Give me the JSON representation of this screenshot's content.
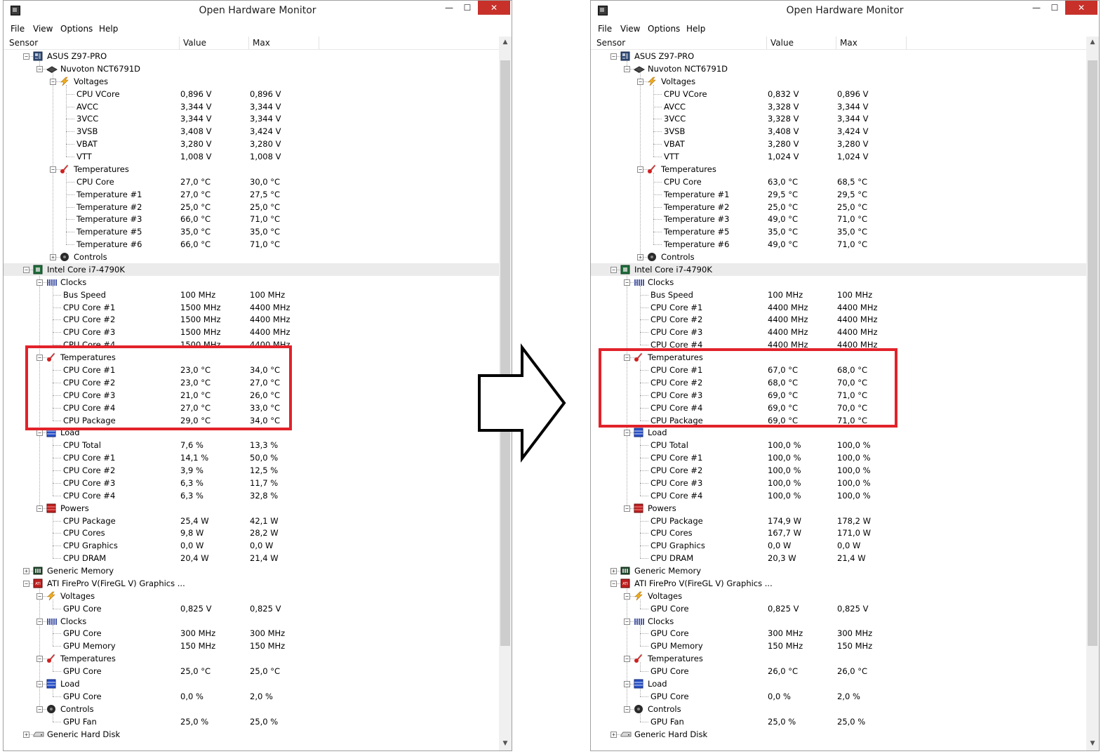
{
  "window": {
    "title": "Open Hardware Monitor",
    "menu": [
      "File",
      "View",
      "Options",
      "Help"
    ],
    "columns": {
      "sensor": "Sensor",
      "value": "Value",
      "max": "Max"
    }
  },
  "tree_before": [
    {
      "label": "ASUS Z97-PRO",
      "level": 1,
      "expander": "minus",
      "icon": "motherboard-icon"
    },
    {
      "label": "Nuvoton NCT6791D",
      "level": 2,
      "expander": "minus",
      "icon": "chip-icon"
    },
    {
      "label": "Voltages",
      "level": 3,
      "expander": "minus",
      "icon": "lightning-icon"
    },
    {
      "label": "CPU VCore",
      "level": 4,
      "value": "0,896 V",
      "max": "0,896 V"
    },
    {
      "label": "AVCC",
      "level": 4,
      "value": "3,344 V",
      "max": "3,344 V"
    },
    {
      "label": "3VCC",
      "level": 4,
      "value": "3,344 V",
      "max": "3,344 V"
    },
    {
      "label": "3VSB",
      "level": 4,
      "value": "3,408 V",
      "max": "3,424 V"
    },
    {
      "label": "VBAT",
      "level": 4,
      "value": "3,280 V",
      "max": "3,280 V"
    },
    {
      "label": "VTT",
      "level": 4,
      "value": "1,008 V",
      "max": "1,008 V"
    },
    {
      "label": "Temperatures",
      "level": 3,
      "expander": "minus",
      "icon": "thermometer-icon"
    },
    {
      "label": "CPU Core",
      "level": 4,
      "value": "27,0 °C",
      "max": "30,0 °C"
    },
    {
      "label": "Temperature #1",
      "level": 4,
      "value": "27,0 °C",
      "max": "27,5 °C"
    },
    {
      "label": "Temperature #2",
      "level": 4,
      "value": "25,0 °C",
      "max": "25,0 °C"
    },
    {
      "label": "Temperature #3",
      "level": 4,
      "value": "66,0 °C",
      "max": "71,0 °C"
    },
    {
      "label": "Temperature #5",
      "level": 4,
      "value": "35,0 °C",
      "max": "35,0 °C"
    },
    {
      "label": "Temperature #6",
      "level": 4,
      "value": "66,0 °C",
      "max": "71,0 °C"
    },
    {
      "label": "Controls",
      "level": 3,
      "expander": "plus",
      "icon": "fan-icon"
    },
    {
      "label": "Intel Core i7-4790K",
      "level": 1,
      "expander": "minus",
      "icon": "cpu-icon",
      "highlight": true
    },
    {
      "label": "Clocks",
      "level": 2,
      "expander": "minus",
      "icon": "clock-icon"
    },
    {
      "label": "Bus Speed",
      "level": 3,
      "value": "100 MHz",
      "max": "100 MHz"
    },
    {
      "label": "CPU Core #1",
      "level": 3,
      "value": "1500 MHz",
      "max": "4400 MHz"
    },
    {
      "label": "CPU Core #2",
      "level": 3,
      "value": "1500 MHz",
      "max": "4400 MHz"
    },
    {
      "label": "CPU Core #3",
      "level": 3,
      "value": "1500 MHz",
      "max": "4400 MHz"
    },
    {
      "label": "CPU Core #4",
      "level": 3,
      "value": "1500 MHz",
      "max": "4400 MHz"
    },
    {
      "label": "Temperatures",
      "level": 2,
      "expander": "minus",
      "icon": "thermometer-icon"
    },
    {
      "label": "CPU Core #1",
      "level": 3,
      "value": "23,0 °C",
      "max": "34,0 °C"
    },
    {
      "label": "CPU Core #2",
      "level": 3,
      "value": "23,0 °C",
      "max": "27,0 °C"
    },
    {
      "label": "CPU Core #3",
      "level": 3,
      "value": "21,0 °C",
      "max": "26,0 °C"
    },
    {
      "label": "CPU Core #4",
      "level": 3,
      "value": "27,0 °C",
      "max": "33,0 °C"
    },
    {
      "label": "CPU Package",
      "level": 3,
      "value": "29,0 °C",
      "max": "34,0 °C"
    },
    {
      "label": "Load",
      "level": 2,
      "expander": "minus",
      "icon": "load-icon"
    },
    {
      "label": "CPU Total",
      "level": 3,
      "value": "7,6 %",
      "max": "13,3 %"
    },
    {
      "label": "CPU Core #1",
      "level": 3,
      "value": "14,1 %",
      "max": "50,0 %"
    },
    {
      "label": "CPU Core #2",
      "level": 3,
      "value": "3,9 %",
      "max": "12,5 %"
    },
    {
      "label": "CPU Core #3",
      "level": 3,
      "value": "6,3 %",
      "max": "11,7 %"
    },
    {
      "label": "CPU Core #4",
      "level": 3,
      "value": "6,3 %",
      "max": "32,8 %"
    },
    {
      "label": "Powers",
      "level": 2,
      "expander": "minus",
      "icon": "power-icon"
    },
    {
      "label": "CPU Package",
      "level": 3,
      "value": "25,4 W",
      "max": "42,1 W"
    },
    {
      "label": "CPU Cores",
      "level": 3,
      "value": "9,8 W",
      "max": "28,2 W"
    },
    {
      "label": "CPU Graphics",
      "level": 3,
      "value": "0,0 W",
      "max": "0,0 W"
    },
    {
      "label": "CPU DRAM",
      "level": 3,
      "value": "20,4 W",
      "max": "21,4 W"
    },
    {
      "label": "Generic Memory",
      "level": 1,
      "expander": "plus",
      "icon": "memory-icon"
    },
    {
      "label": "ATI FirePro V(FireGL V) Graphics ...",
      "level": 1,
      "expander": "minus",
      "icon": "gpu-icon"
    },
    {
      "label": "Voltages",
      "level": 2,
      "expander": "minus",
      "icon": "lightning-icon"
    },
    {
      "label": "GPU Core",
      "level": 3,
      "value": "0,825 V",
      "max": "0,825 V"
    },
    {
      "label": "Clocks",
      "level": 2,
      "expander": "minus",
      "icon": "clock-icon"
    },
    {
      "label": "GPU Core",
      "level": 3,
      "value": "300 MHz",
      "max": "300 MHz"
    },
    {
      "label": "GPU Memory",
      "level": 3,
      "value": "150 MHz",
      "max": "150 MHz"
    },
    {
      "label": "Temperatures",
      "level": 2,
      "expander": "minus",
      "icon": "thermometer-icon"
    },
    {
      "label": "GPU Core",
      "level": 3,
      "value": "25,0 °C",
      "max": "25,0 °C"
    },
    {
      "label": "Load",
      "level": 2,
      "expander": "minus",
      "icon": "load-icon"
    },
    {
      "label": "GPU Core",
      "level": 3,
      "value": "0,0 %",
      "max": "2,0 %"
    },
    {
      "label": "Controls",
      "level": 2,
      "expander": "minus",
      "icon": "fan-icon"
    },
    {
      "label": "GPU Fan",
      "level": 3,
      "value": "25,0 %",
      "max": "25,0 %"
    },
    {
      "label": "Generic Hard Disk",
      "level": 1,
      "expander": "plus",
      "icon": "disk-icon"
    }
  ],
  "tree_after": [
    {
      "label": "ASUS Z97-PRO",
      "level": 1,
      "expander": "minus",
      "icon": "motherboard-icon"
    },
    {
      "label": "Nuvoton NCT6791D",
      "level": 2,
      "expander": "minus",
      "icon": "chip-icon"
    },
    {
      "label": "Voltages",
      "level": 3,
      "expander": "minus",
      "icon": "lightning-icon"
    },
    {
      "label": "CPU VCore",
      "level": 4,
      "value": "0,832 V",
      "max": "0,896 V"
    },
    {
      "label": "AVCC",
      "level": 4,
      "value": "3,328 V",
      "max": "3,344 V"
    },
    {
      "label": "3VCC",
      "level": 4,
      "value": "3,328 V",
      "max": "3,344 V"
    },
    {
      "label": "3VSB",
      "level": 4,
      "value": "3,408 V",
      "max": "3,424 V"
    },
    {
      "label": "VBAT",
      "level": 4,
      "value": "3,280 V",
      "max": "3,280 V"
    },
    {
      "label": "VTT",
      "level": 4,
      "value": "1,024 V",
      "max": "1,024 V"
    },
    {
      "label": "Temperatures",
      "level": 3,
      "expander": "minus",
      "icon": "thermometer-icon"
    },
    {
      "label": "CPU Core",
      "level": 4,
      "value": "63,0 °C",
      "max": "68,5 °C"
    },
    {
      "label": "Temperature #1",
      "level": 4,
      "value": "29,5 °C",
      "max": "29,5 °C"
    },
    {
      "label": "Temperature #2",
      "level": 4,
      "value": "25,0 °C",
      "max": "25,0 °C"
    },
    {
      "label": "Temperature #3",
      "level": 4,
      "value": "49,0 °C",
      "max": "71,0 °C"
    },
    {
      "label": "Temperature #5",
      "level": 4,
      "value": "35,0 °C",
      "max": "35,0 °C"
    },
    {
      "label": "Temperature #6",
      "level": 4,
      "value": "49,0 °C",
      "max": "71,0 °C"
    },
    {
      "label": "Controls",
      "level": 3,
      "expander": "plus",
      "icon": "fan-icon"
    },
    {
      "label": "Intel Core i7-4790K",
      "level": 1,
      "expander": "minus",
      "icon": "cpu-icon",
      "highlight": true
    },
    {
      "label": "Clocks",
      "level": 2,
      "expander": "minus",
      "icon": "clock-icon"
    },
    {
      "label": "Bus Speed",
      "level": 3,
      "value": "100 MHz",
      "max": "100 MHz"
    },
    {
      "label": "CPU Core #1",
      "level": 3,
      "value": "4400 MHz",
      "max": "4400 MHz"
    },
    {
      "label": "CPU Core #2",
      "level": 3,
      "value": "4400 MHz",
      "max": "4400 MHz"
    },
    {
      "label": "CPU Core #3",
      "level": 3,
      "value": "4400 MHz",
      "max": "4400 MHz"
    },
    {
      "label": "CPU Core #4",
      "level": 3,
      "value": "4400 MHz",
      "max": "4400 MHz"
    },
    {
      "label": "Temperatures",
      "level": 2,
      "expander": "minus",
      "icon": "thermometer-icon"
    },
    {
      "label": "CPU Core #1",
      "level": 3,
      "value": "67,0 °C",
      "max": "68,0 °C"
    },
    {
      "label": "CPU Core #2",
      "level": 3,
      "value": "68,0 °C",
      "max": "70,0 °C"
    },
    {
      "label": "CPU Core #3",
      "level": 3,
      "value": "69,0 °C",
      "max": "71,0 °C"
    },
    {
      "label": "CPU Core #4",
      "level": 3,
      "value": "69,0 °C",
      "max": "70,0 °C"
    },
    {
      "label": "CPU Package",
      "level": 3,
      "value": "69,0 °C",
      "max": "71,0 °C"
    },
    {
      "label": "Load",
      "level": 2,
      "expander": "minus",
      "icon": "load-icon"
    },
    {
      "label": "CPU Total",
      "level": 3,
      "value": "100,0 %",
      "max": "100,0 %"
    },
    {
      "label": "CPU Core #1",
      "level": 3,
      "value": "100,0 %",
      "max": "100,0 %"
    },
    {
      "label": "CPU Core #2",
      "level": 3,
      "value": "100,0 %",
      "max": "100,0 %"
    },
    {
      "label": "CPU Core #3",
      "level": 3,
      "value": "100,0 %",
      "max": "100,0 %"
    },
    {
      "label": "CPU Core #4",
      "level": 3,
      "value": "100,0 %",
      "max": "100,0 %"
    },
    {
      "label": "Powers",
      "level": 2,
      "expander": "minus",
      "icon": "power-icon"
    },
    {
      "label": "CPU Package",
      "level": 3,
      "value": "174,9 W",
      "max": "178,2 W"
    },
    {
      "label": "CPU Cores",
      "level": 3,
      "value": "167,7 W",
      "max": "171,0 W"
    },
    {
      "label": "CPU Graphics",
      "level": 3,
      "value": "0,0 W",
      "max": "0,0 W"
    },
    {
      "label": "CPU DRAM",
      "level": 3,
      "value": "20,3 W",
      "max": "21,4 W"
    },
    {
      "label": "Generic Memory",
      "level": 1,
      "expander": "plus",
      "icon": "memory-icon"
    },
    {
      "label": "ATI FirePro V(FireGL V) Graphics ...",
      "level": 1,
      "expander": "minus",
      "icon": "gpu-icon"
    },
    {
      "label": "Voltages",
      "level": 2,
      "expander": "minus",
      "icon": "lightning-icon"
    },
    {
      "label": "GPU Core",
      "level": 3,
      "value": "0,825 V",
      "max": "0,825 V"
    },
    {
      "label": "Clocks",
      "level": 2,
      "expander": "minus",
      "icon": "clock-icon"
    },
    {
      "label": "GPU Core",
      "level": 3,
      "value": "300 MHz",
      "max": "300 MHz"
    },
    {
      "label": "GPU Memory",
      "level": 3,
      "value": "150 MHz",
      "max": "150 MHz"
    },
    {
      "label": "Temperatures",
      "level": 2,
      "expander": "minus",
      "icon": "thermometer-icon"
    },
    {
      "label": "GPU Core",
      "level": 3,
      "value": "26,0 °C",
      "max": "26,0 °C"
    },
    {
      "label": "Load",
      "level": 2,
      "expander": "minus",
      "icon": "load-icon"
    },
    {
      "label": "GPU Core",
      "level": 3,
      "value": "0,0 %",
      "max": "2,0 %"
    },
    {
      "label": "Controls",
      "level": 2,
      "expander": "minus",
      "icon": "fan-icon"
    },
    {
      "label": "GPU Fan",
      "level": 3,
      "value": "25,0 %",
      "max": "25,0 %"
    },
    {
      "label": "Generic Hard Disk",
      "level": 1,
      "expander": "plus",
      "icon": "disk-icon"
    }
  ],
  "highlight_color": "#e2222a"
}
